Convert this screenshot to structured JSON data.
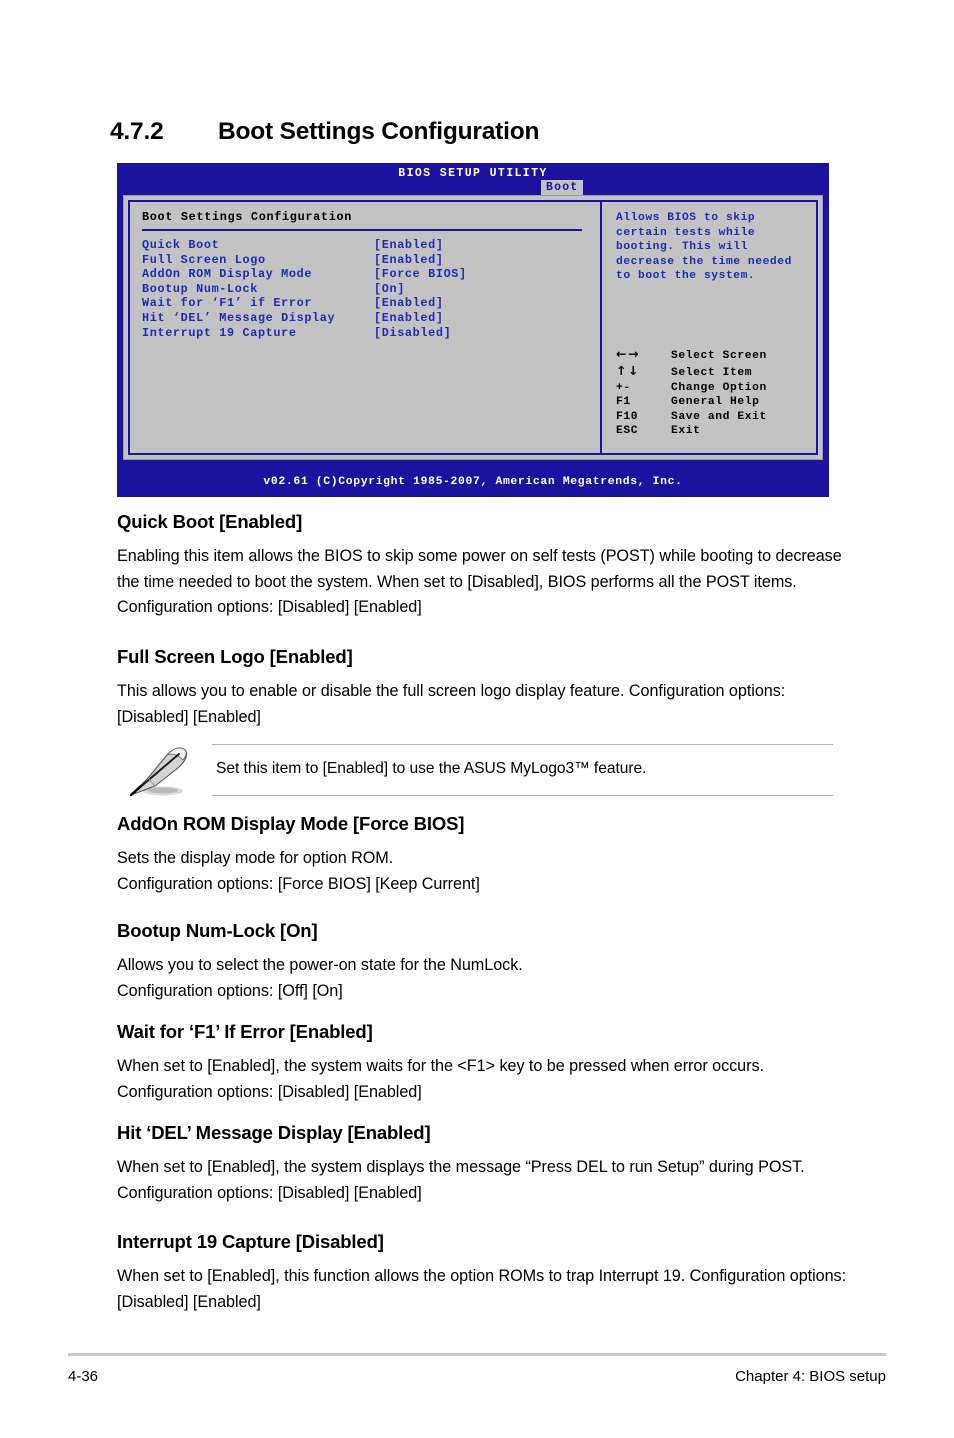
{
  "section": {
    "number": "4.7.2",
    "title": "Boot Settings Configuration"
  },
  "bios": {
    "title": "BIOS SETUP UTILITY",
    "active_tab": "Boot",
    "pane_title": "Boot Settings Configuration",
    "options": [
      {
        "label": "Quick Boot",
        "value": "[Enabled]"
      },
      {
        "label": "Full Screen Logo",
        "value": "[Enabled]"
      },
      {
        "label": "AddOn ROM Display Mode",
        "value": "[Force BIOS]"
      },
      {
        "label": "Bootup Num-Lock",
        "value": "[On]"
      },
      {
        "label": "Wait for ‘F1’ if Error",
        "value": "[Enabled]"
      },
      {
        "label": "Hit ‘DEL’ Message Display",
        "value": "[Enabled]"
      },
      {
        "label": "Interrupt 19 Capture",
        "value": "[Disabled]"
      }
    ],
    "help_lines": [
      "Allows BIOS to skip",
      "certain tests while",
      "booting. This will",
      "decrease the time needed",
      "to boot the system."
    ],
    "legend": [
      {
        "key": "←→",
        "action": "Select Screen",
        "arrows": true
      },
      {
        "key": "↑↓",
        "action": "Select Item",
        "arrows": true
      },
      {
        "key": "+-",
        "action": "Change Option",
        "arrows": false
      },
      {
        "key": "F1",
        "action": "General Help",
        "arrows": false
      },
      {
        "key": "F10",
        "action": "Save and Exit",
        "arrows": false
      },
      {
        "key": "ESC",
        "action": "Exit",
        "arrows": false
      }
    ],
    "footer": "v02.61 (C)Copyright 1985-2007, American Megatrends, Inc.",
    "colors": {
      "background": "#1b12a0",
      "panel": "#c3c3c3",
      "text_blue": "#1b2db0",
      "tab_background": "#c3c3c3"
    }
  },
  "sections": [
    {
      "heading": "Quick Boot [Enabled]",
      "body": "Enabling this item allows the BIOS to skip some power on self tests (POST) while booting to decrease the time needed to boot the system. When set to [Disabled], BIOS performs all the POST items. Configuration options: [Disabled] [Enabled]"
    },
    {
      "heading": "Full Screen Logo [Enabled]",
      "body": "This allows you to enable or disable the full screen logo display feature. Configuration options: [Disabled] [Enabled]"
    },
    {
      "heading": "AddOn ROM Display Mode [Force BIOS]",
      "body": "Sets the display mode for option ROM.\nConfiguration options: [Force BIOS] [Keep Current]"
    },
    {
      "heading": "Bootup Num-Lock [On]",
      "body": "Allows you to select the power-on state for the NumLock.\nConfiguration options: [Off] [On]"
    },
    {
      "heading": "Wait for ‘F1’ If Error [Enabled]",
      "body": "When set to [Enabled], the system waits for the <F1> key to be pressed when error occurs. Configuration options: [Disabled] [Enabled]"
    },
    {
      "heading": "Hit ‘DEL’ Message Display [Enabled]",
      "body": "When set to [Enabled], the system displays the message “Press DEL to run Setup” during POST. Configuration options: [Disabled] [Enabled]"
    },
    {
      "heading": "Interrupt 19 Capture [Disabled]",
      "body": "When set to [Enabled], this function allows the option ROMs to trap Interrupt 19. Configuration options: [Disabled] [Enabled]"
    }
  ],
  "note": {
    "text": "Set this item to [Enabled] to use the ASUS MyLogo3™ feature.",
    "icon": "pen-note-icon"
  },
  "page_footer": {
    "page_number": "4-36",
    "chapter": "Chapter 4: BIOS setup"
  }
}
